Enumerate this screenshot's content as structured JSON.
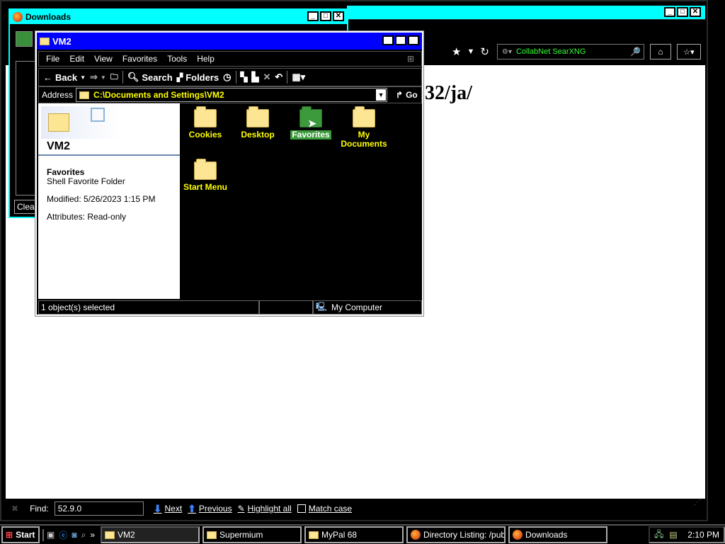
{
  "browser": {
    "search_engine_label": "CollabNet SearXNG",
    "page_heading_fragment": "32/ja/",
    "findbar": {
      "label": "Find:",
      "value": "52.9.0",
      "next": "Next",
      "previous": "Previous",
      "highlight_all": "Highlight all",
      "match_case": "Match case"
    }
  },
  "downloads_window": {
    "title": "Downloads",
    "clear_button_fragment": "Clea"
  },
  "explorer": {
    "title": "VM2",
    "menu": [
      "File",
      "Edit",
      "View",
      "Favorites",
      "Tools",
      "Help"
    ],
    "toolbar": {
      "back": "Back",
      "search": "Search",
      "folders": "Folders"
    },
    "address": {
      "label": "Address",
      "value": "C:\\Documents and Settings\\VM2",
      "go": "Go"
    },
    "sidebar": {
      "folder_name": "VM2",
      "selected_name": "Favorites",
      "selected_type": "Shell Favorite Folder",
      "modified": "Modified: 5/26/2023 1:15 PM",
      "attributes": "Attributes: Read-only"
    },
    "items": [
      {
        "label": "Cookies"
      },
      {
        "label": "Desktop"
      },
      {
        "label": "Favorites"
      },
      {
        "label": "My Documents"
      },
      {
        "label": "Start Menu"
      }
    ],
    "status": {
      "selection": "1 object(s) selected",
      "zone": "My Computer"
    }
  },
  "taskbar": {
    "start": "Start",
    "tasks": [
      {
        "label": "VM2"
      },
      {
        "label": "Supermium"
      },
      {
        "label": "MyPal 68"
      },
      {
        "label": "Directory Listing: /pub..."
      },
      {
        "label": "Downloads"
      }
    ],
    "clock": "2:10 PM"
  },
  "colors": {
    "title_active": "#0000ff",
    "title_inactive": "#00ffff",
    "folder_text": "#ffff00",
    "selection": "#3c9a3c"
  }
}
